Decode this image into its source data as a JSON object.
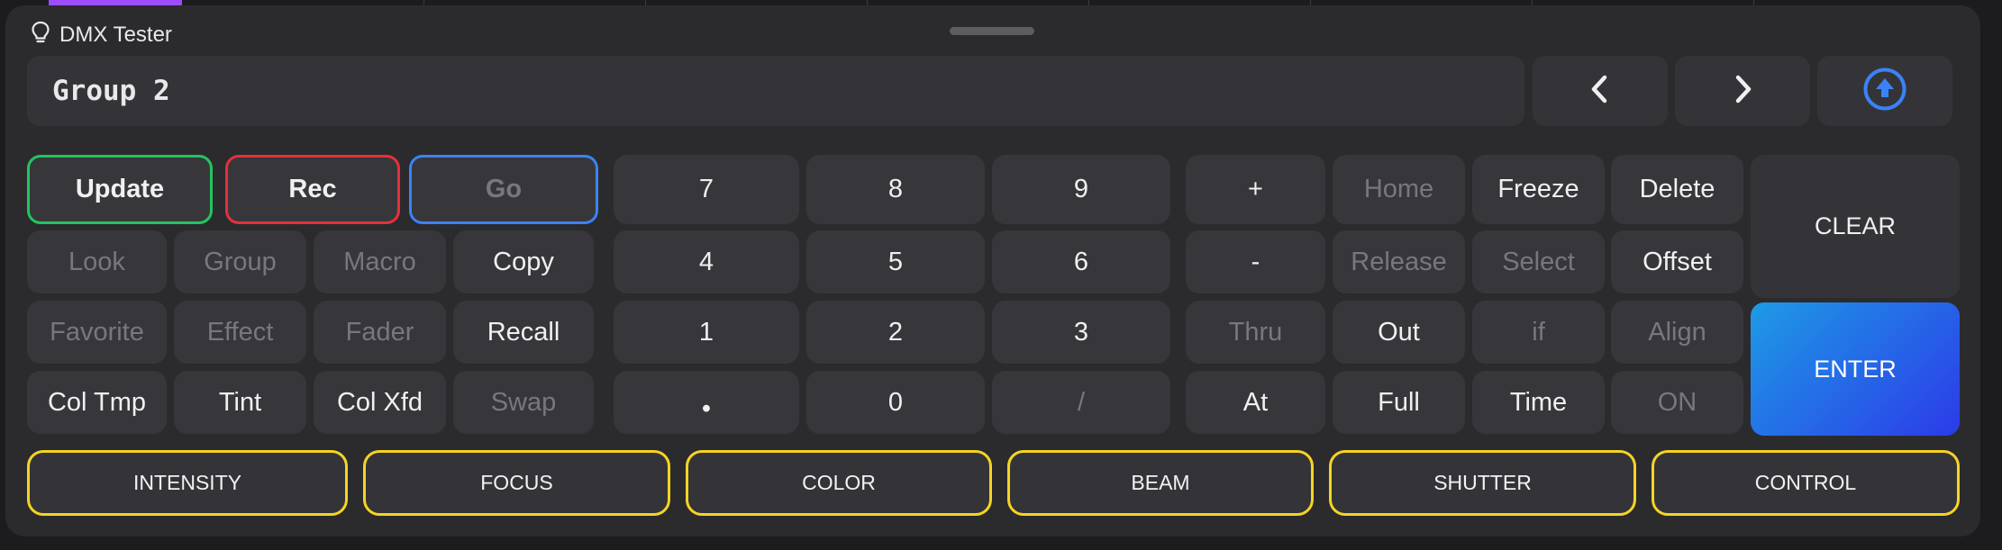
{
  "app": {
    "title": "DMX Tester"
  },
  "command_line": {
    "value": "Group 2"
  },
  "nav": {
    "prev_icon": "chevron-left-icon",
    "next_icon": "chevron-right-icon",
    "upload_icon": "arrow-up-circle-icon"
  },
  "keys": {
    "update": "Update",
    "rec": "Rec",
    "go": "Go",
    "look": "Look",
    "group": "Group",
    "macro": "Macro",
    "copy": "Copy",
    "favorite": "Favorite",
    "effect": "Effect",
    "fader": "Fader",
    "recall": "Recall",
    "col_tmp": "Col Tmp",
    "tint": "Tint",
    "col_xfd": "Col Xfd",
    "swap": "Swap",
    "n7": "7",
    "n8": "8",
    "n9": "9",
    "n4": "4",
    "n5": "5",
    "n6": "6",
    "n1": "1",
    "n2": "2",
    "n3": "3",
    "dot": "•",
    "n0": "0",
    "slash": "/",
    "plus": "+",
    "minus": "-",
    "thru": "Thru",
    "at": "At",
    "home": "Home",
    "release": "Release",
    "out": "Out",
    "full": "Full",
    "freeze": "Freeze",
    "select": "Select",
    "if": "if",
    "time": "Time",
    "delete": "Delete",
    "offset": "Offset",
    "align": "Align",
    "on": "ON",
    "clear": "CLEAR",
    "enter": "ENTER"
  },
  "attributes": [
    "INTENSITY",
    "FOCUS",
    "COLOR",
    "BEAM",
    "SHUTTER",
    "CONTROL"
  ],
  "colors": {
    "update_border": "#22c55e",
    "rec_border": "#e5303b",
    "go_border": "#3b82f6",
    "attribute_border": "#f5d424",
    "enter_gradient_start": "#1e9be6",
    "enter_gradient_end": "#2c3ae8",
    "tab_active": "#9b4dff"
  }
}
